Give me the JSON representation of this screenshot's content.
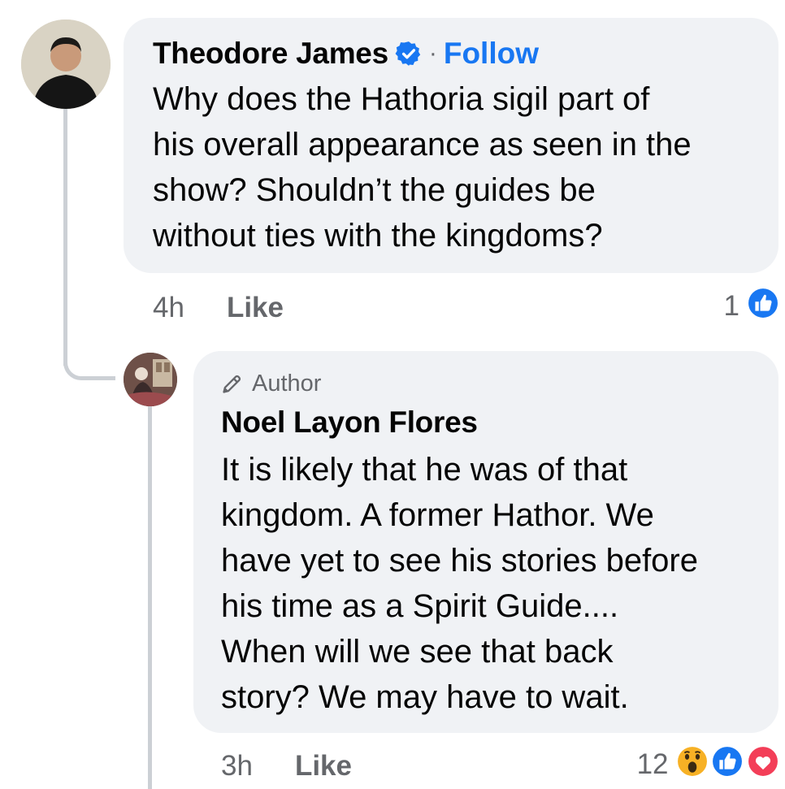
{
  "main_comment": {
    "author": "Theodore James",
    "separator": "·",
    "follow_label": "Follow",
    "text": "Why does the Hathoria sigil part of\nhis overall appearance as seen in the\nshow? Shouldn’t the guides be\nwithout ties with the kingdoms?",
    "timestamp": "4h",
    "like_label": "Like",
    "reaction_count": "1",
    "reactions": [
      "like-icon"
    ],
    "verified_icon": "verified-badge-icon"
  },
  "reply_comment": {
    "badge_label": "Author",
    "badge_icon": "pencil-icon",
    "author": "Noel Layon Flores",
    "text": "It is likely that he was of that\nkingdom. A former Hathor. We\nhave yet to see his stories before\nhis time as a Spirit Guide....\nWhen will we see that back\nstory? We may have to wait.",
    "timestamp": "3h",
    "like_label": "Like",
    "reaction_count": "12",
    "reactions": [
      "wow-icon",
      "like-icon",
      "love-icon"
    ]
  },
  "colors": {
    "bubble": "#f0f2f5",
    "link": "#1877f2",
    "muted": "#65676b",
    "thread_line": "#ccd0d5",
    "love": "#f33e58",
    "wow": "#f7b125"
  }
}
